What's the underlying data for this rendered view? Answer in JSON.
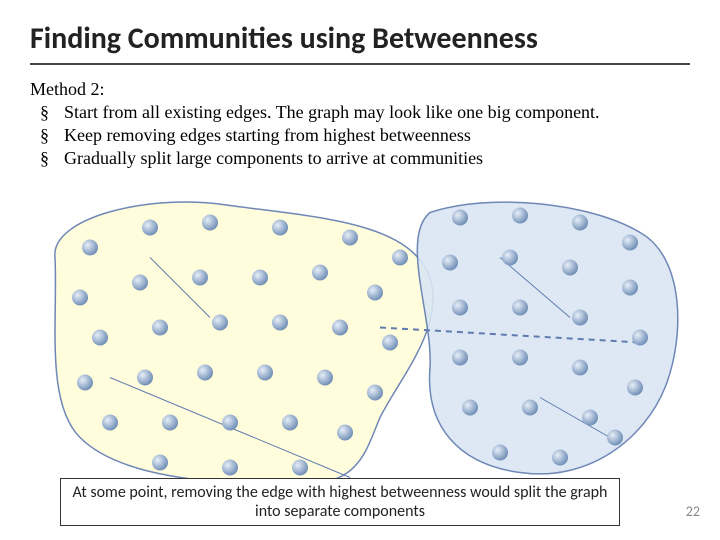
{
  "title": "Finding Communities using Betweenness",
  "method_label": "Method 2:",
  "bullets": [
    "Start from all existing edges. The graph may look like one big component.",
    "Keep removing edges starting from highest betweenness",
    "Gradually split large components to arrive at communities"
  ],
  "caption": "At some point, removing the edge with highest betweenness would split the graph into separate components",
  "page_number": "22",
  "diagram": {
    "communities": [
      {
        "name": "community-left",
        "color": "yellow"
      },
      {
        "name": "community-right",
        "color": "blue"
      }
    ],
    "removed_edge": "dashed edge between the two communities",
    "node_count_left": 32,
    "node_count_right": 22
  },
  "colors": {
    "node_fill_light": "#c7d7ea",
    "node_fill_dark": "#6c8bb4",
    "blob_yellow": "#fffdd8",
    "blob_blue": "#dae6f3",
    "blob_stroke": "#5f7bb0"
  }
}
